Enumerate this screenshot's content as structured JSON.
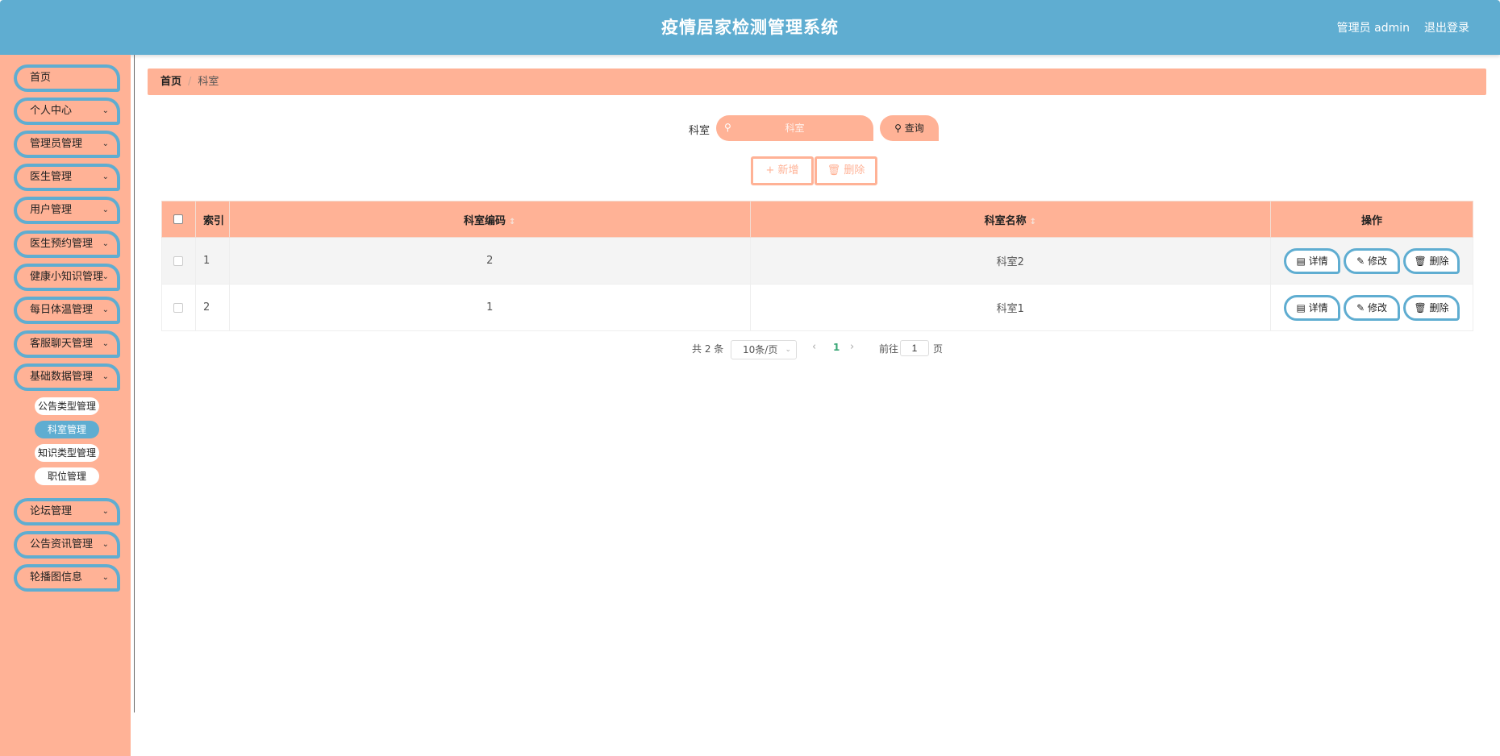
{
  "header": {
    "title": "疫情居家检测管理系统",
    "user": "管理员 admin",
    "logout": "退出登录"
  },
  "sidebar": {
    "items": [
      {
        "label": "首页"
      },
      {
        "label": "个人中心"
      },
      {
        "label": "管理员管理"
      },
      {
        "label": "医生管理"
      },
      {
        "label": "用户管理"
      },
      {
        "label": "医生预约管理"
      },
      {
        "label": "健康小知识管理"
      },
      {
        "label": "每日体温管理"
      },
      {
        "label": "客服聊天管理"
      },
      {
        "label": "基础数据管理"
      },
      {
        "label": "论坛管理"
      },
      {
        "label": "公告资讯管理"
      },
      {
        "label": "轮播图信息"
      }
    ],
    "sub_items": [
      {
        "label": "公告类型管理"
      },
      {
        "label": "科室管理"
      },
      {
        "label": "知识类型管理"
      },
      {
        "label": "职位管理"
      }
    ]
  },
  "breadcrumb": {
    "home": "首页",
    "current": "科室"
  },
  "search": {
    "label": "科室",
    "placeholder": "科室",
    "query_label": "查询"
  },
  "actions": {
    "add_label": "新增",
    "delete_label": "删除"
  },
  "table": {
    "headers": {
      "index": "索引",
      "code": "科室编码",
      "name": "科室名称",
      "operation": "操作"
    },
    "rows": [
      {
        "index": "1",
        "code": "2",
        "name": "科室2"
      },
      {
        "index": "2",
        "code": "1",
        "name": "科室1"
      }
    ],
    "row_actions": {
      "detail": "详情",
      "edit": "修改",
      "delete": "删除"
    }
  },
  "pagination": {
    "total": "共 2 条",
    "page_size": "10条/页",
    "current_page": "1",
    "goto_label": "前往",
    "goto_value": "1",
    "page_unit": "页"
  },
  "colors": {
    "primary": "#5fadd1",
    "accent": "#ffb296"
  }
}
